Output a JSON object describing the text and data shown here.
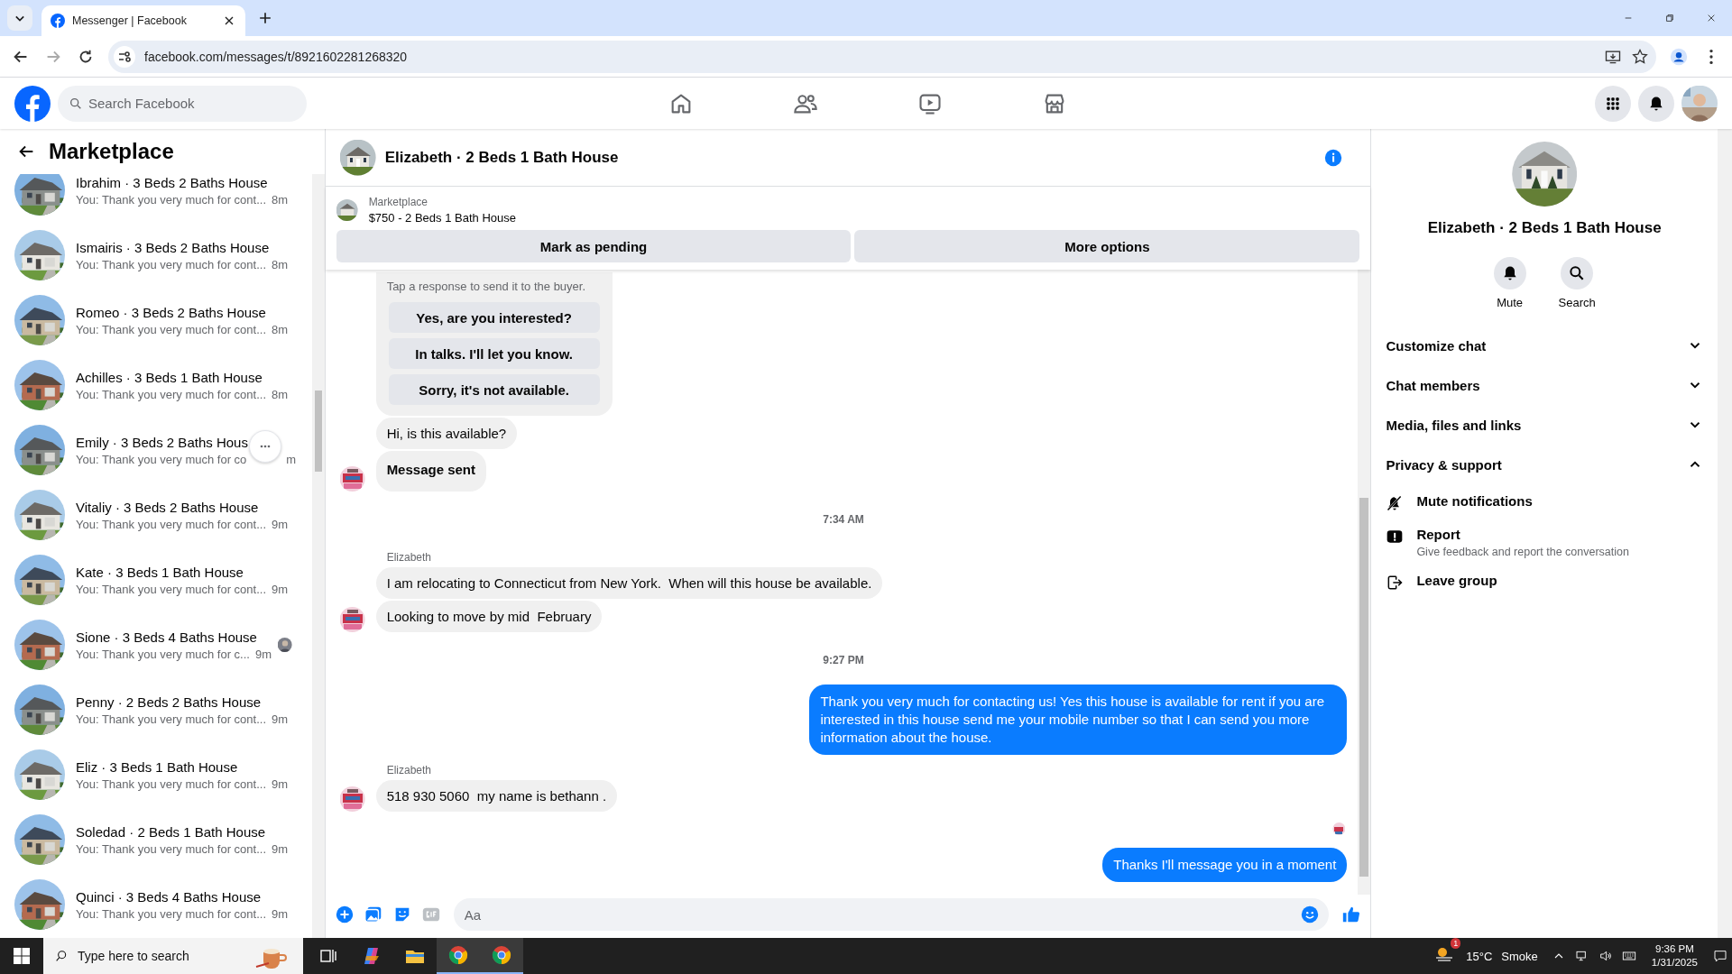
{
  "browser": {
    "tab_title": "Messenger | Facebook",
    "url": "facebook.com/messages/t/8921602281268320"
  },
  "header": {
    "search": {
      "placeholder": "Search Facebook"
    }
  },
  "sidebar": {
    "title": "Marketplace",
    "conversations": [
      {
        "name": "Ibrahim · 3 Beds 2 Baths House",
        "preview": "You: Thank you very much for cont...",
        "time": "8m",
        "hovered": false,
        "seen": false
      },
      {
        "name": "Ismairis · 3 Beds 2 Baths House",
        "preview": "You: Thank you very much for cont...",
        "time": "8m",
        "hovered": false,
        "seen": false
      },
      {
        "name": "Romeo · 3 Beds 2 Baths House",
        "preview": "You: Thank you very much for cont...",
        "time": "8m",
        "hovered": false,
        "seen": false
      },
      {
        "name": "Achilles · 3 Beds 1 Bath House",
        "preview": "You: Thank you very much for cont...",
        "time": "8m",
        "hovered": false,
        "seen": false
      },
      {
        "name": "Emily · 3 Beds 2 Baths Hous",
        "preview": "You: Thank you very much for co",
        "time": "m",
        "hovered": true,
        "seen": false
      },
      {
        "name": "Vitaliy · 3 Beds 2 Baths House",
        "preview": "You: Thank you very much for cont...",
        "time": "9m",
        "hovered": false,
        "seen": false
      },
      {
        "name": "Kate · 3 Beds 1 Bath House",
        "preview": "You: Thank you very much for cont...",
        "time": "9m",
        "hovered": false,
        "seen": false
      },
      {
        "name": "Sione · 3 Beds 4 Baths House",
        "preview": "You: Thank you very much for c...",
        "time": "9m",
        "hovered": false,
        "seen": true
      },
      {
        "name": "Penny · 2 Beds 2 Baths House",
        "preview": "You: Thank you very much for cont...",
        "time": "9m",
        "hovered": false,
        "seen": false
      },
      {
        "name": "Eliz · 3 Beds 1 Bath House",
        "preview": "You: Thank you very much for cont...",
        "time": "9m",
        "hovered": false,
        "seen": false
      },
      {
        "name": "Soledad · 2 Beds 1 Bath House",
        "preview": "You: Thank you very much for cont...",
        "time": "9m",
        "hovered": false,
        "seen": false
      },
      {
        "name": "Quinci · 3 Beds 4 Baths House",
        "preview": "You: Thank you very much for cont...",
        "time": "9m",
        "hovered": false,
        "seen": false
      }
    ]
  },
  "chat": {
    "title": "Elizabeth · 2 Beds 1 Bath House",
    "listing": {
      "label": "Marketplace",
      "item": "$750 - 2 Beds 1 Bath House",
      "buttons": [
        "Mark as pending",
        "More options"
      ]
    },
    "messages": [
      {
        "kind": "quick_replies",
        "hint": "Tap a response to send it to the buyer.",
        "options": [
          "Yes, are you interested?",
          "In talks. I'll let you know.",
          "Sorry, it's not available."
        ]
      },
      {
        "kind": "incoming",
        "text": "Hi, is this available?",
        "avatar": false,
        "emphasis": false
      },
      {
        "kind": "incoming",
        "text": "Message sent",
        "avatar": true,
        "emphasis": true
      },
      {
        "kind": "timestamp",
        "text": "7:34 AM"
      },
      {
        "kind": "incoming",
        "sender": "Elizabeth",
        "text": "I am relocating to Connecticut from New York.  When will this house be available.",
        "avatar": false,
        "emphasis": false
      },
      {
        "kind": "incoming",
        "text": "Looking to move by mid  February",
        "avatar": true,
        "emphasis": false
      },
      {
        "kind": "timestamp",
        "text": "9:27 PM"
      },
      {
        "kind": "outgoing",
        "text": "Thank you very much for contacting us! Yes this house is available for rent if you are interested in this house send me your mobile number so that I can send you more information about the house.",
        "seen": false
      },
      {
        "kind": "incoming",
        "sender": "Elizabeth",
        "text": "518 930 5060  my name is bethann .",
        "avatar": true,
        "emphasis": false
      },
      {
        "kind": "outgoing",
        "text": "Thanks I'll message you in a moment",
        "seen": true
      }
    ],
    "composer": {
      "placeholder": "Aa"
    }
  },
  "details": {
    "title": "Elizabeth · 2 Beds 1 Bath House",
    "actions": [
      {
        "kind": "mute",
        "label": "Mute"
      },
      {
        "kind": "search",
        "label": "Search"
      }
    ],
    "sections": [
      {
        "label": "Customize chat",
        "expanded": false
      },
      {
        "label": "Chat members",
        "expanded": false
      },
      {
        "label": "Media, files and links",
        "expanded": false
      },
      {
        "label": "Privacy & support",
        "expanded": true
      }
    ],
    "privacy_items": [
      {
        "kind": "mute",
        "label": "Mute notifications"
      },
      {
        "kind": "report",
        "label": "Report",
        "description": "Give feedback and report the conversation"
      },
      {
        "kind": "leave",
        "label": "Leave group"
      }
    ]
  },
  "taskbar": {
    "search_placeholder": "Type here to search",
    "weather_badge": "1",
    "temperature": "15°C",
    "condition": "Smoke",
    "time": "9:36 PM",
    "date": "1/31/2025"
  }
}
